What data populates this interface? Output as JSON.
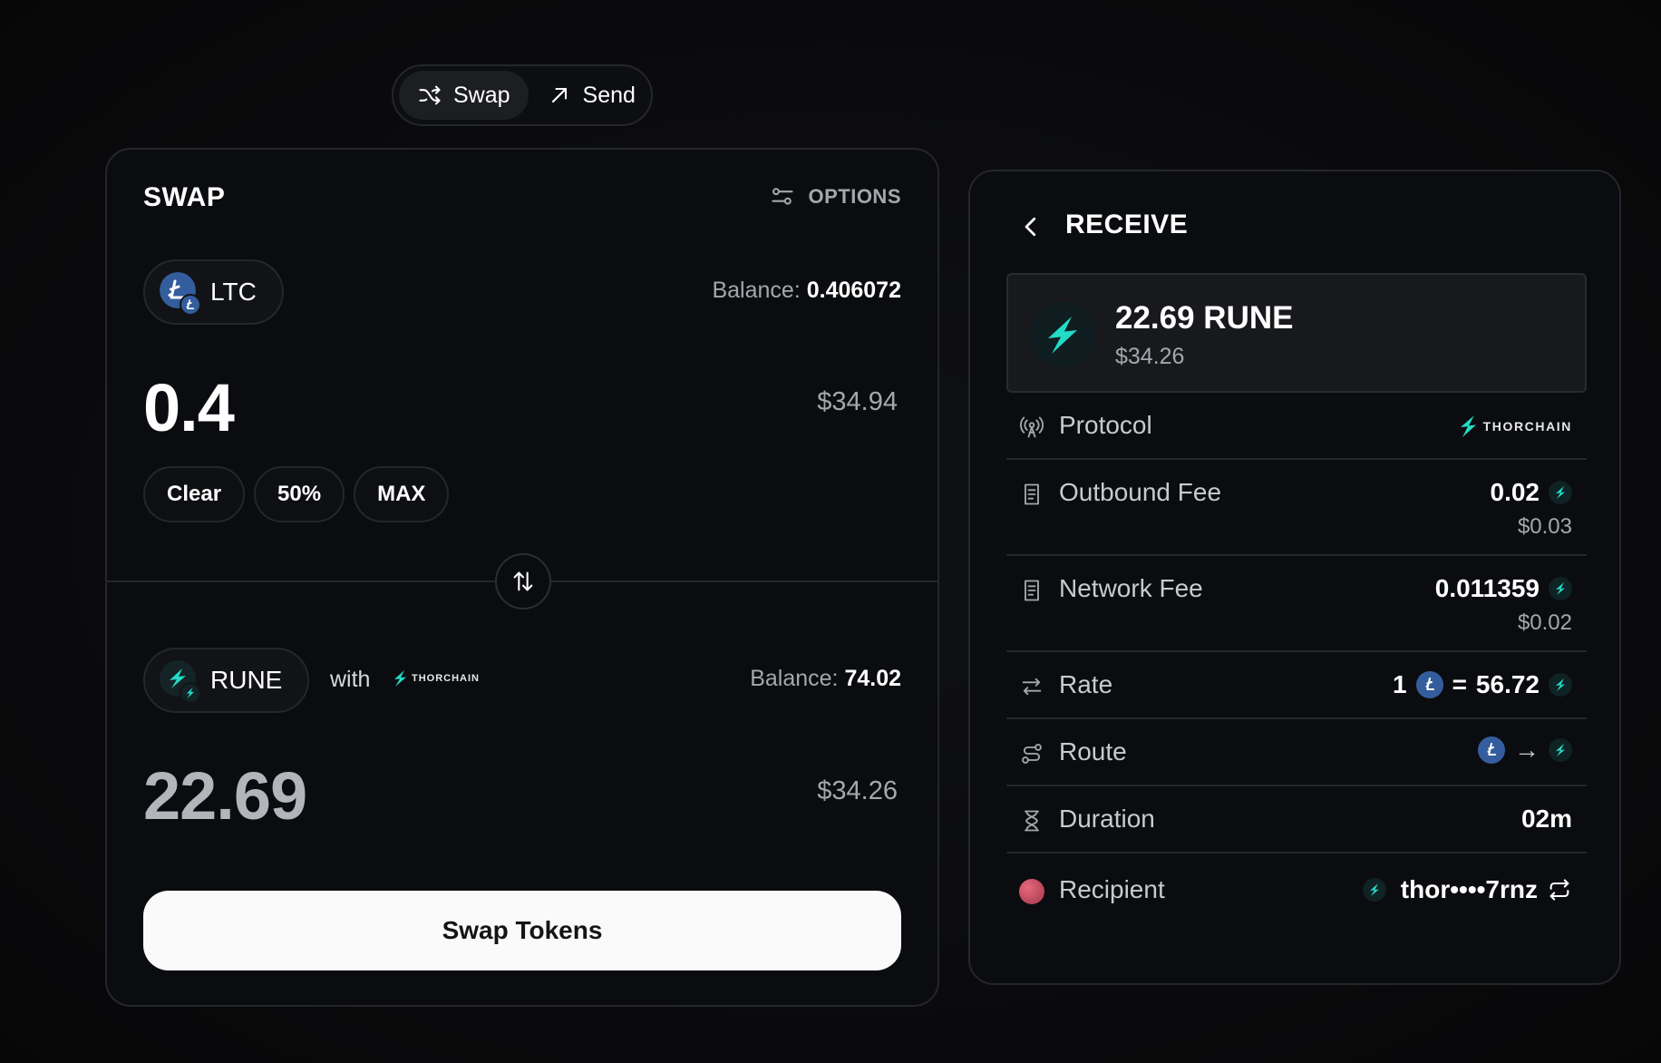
{
  "mode_toggle": {
    "swap_label": "Swap",
    "send_label": "Send",
    "active": "swap"
  },
  "swap_card": {
    "title": "SWAP",
    "options_label": "OPTIONS",
    "from": {
      "token": "LTC",
      "balance_label": "Balance:",
      "balance_value": "0.406072",
      "amount": "0.4",
      "usd_value": "$34.94"
    },
    "chips": [
      "Clear",
      "50%",
      "MAX"
    ],
    "to": {
      "token": "RUNE",
      "with_label": "with",
      "provider": "THORCHAIN",
      "balance_label": "Balance:",
      "balance_value": "74.02",
      "amount": "22.69",
      "usd_value": "$34.26"
    },
    "submit_label": "Swap Tokens"
  },
  "receive_card": {
    "title": "RECEIVE",
    "amount": "22.69 RUNE",
    "usd_value": "$34.26",
    "rows": {
      "protocol": {
        "label": "Protocol",
        "value": "THORCHAIN"
      },
      "outbound_fee": {
        "label": "Outbound Fee",
        "value": "0.02",
        "usd": "$0.03"
      },
      "network_fee": {
        "label": "Network Fee",
        "value": "0.011359",
        "usd": "$0.02"
      },
      "rate": {
        "label": "Rate",
        "left": "1",
        "eq": "=",
        "right": "56.72"
      },
      "route": {
        "label": "Route",
        "arrow": "→"
      },
      "duration": {
        "label": "Duration",
        "value": "02m"
      },
      "recipient": {
        "label": "Recipient",
        "value": "thor••••7rnz"
      }
    }
  },
  "colors": {
    "background": "#0a0a0c",
    "card": "#0b0c0f",
    "border": "#25262b",
    "thorchain_teal": "#23dcc8",
    "ltc_blue": "#345d9d",
    "button_bg": "#fafafa"
  }
}
